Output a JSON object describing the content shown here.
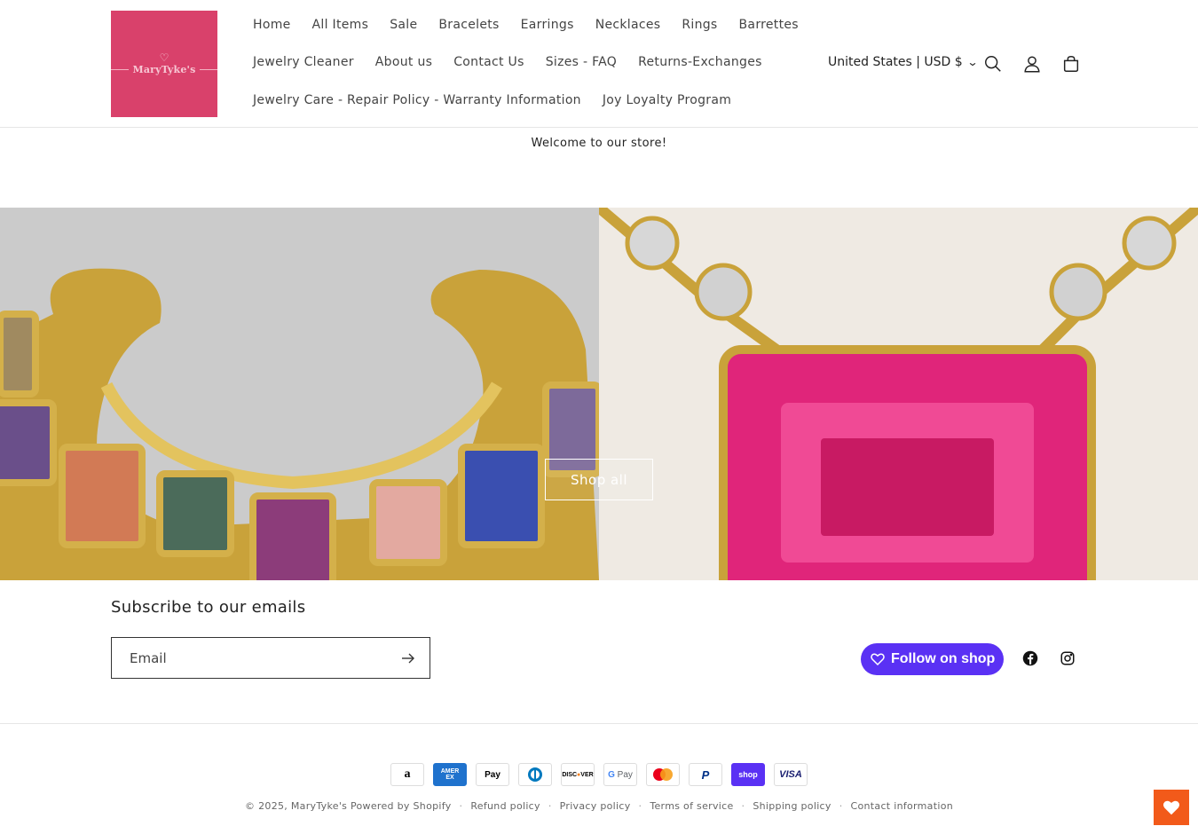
{
  "brand": {
    "logo_text": "MaryTyke's"
  },
  "nav": {
    "row1": [
      "Home",
      "All Items",
      "Sale",
      "Bracelets",
      "Earrings",
      "Necklaces",
      "Rings",
      "Barrettes"
    ],
    "row2": [
      "Jewelry Cleaner",
      "About us",
      "Contact Us",
      "Sizes - FAQ",
      "Returns-Exchanges"
    ],
    "row3": [
      "Jewelry Care - Repair Policy - Warranty Information",
      "Joy Loyalty Program"
    ]
  },
  "header": {
    "country": "United States | USD $",
    "icons": [
      "search-icon",
      "account-icon",
      "cart-icon"
    ]
  },
  "announcement": "Welcome to our store!",
  "hero": {
    "button_label": "Shop all"
  },
  "newsletter": {
    "title": "Subscribe to our emails",
    "placeholder": "Email"
  },
  "social": {
    "follow_label": "Follow on shop",
    "icons": [
      "facebook-icon",
      "instagram-icon"
    ]
  },
  "payments": [
    "Amazon",
    "American Express",
    "Apple Pay",
    "Diners Club",
    "Discover",
    "Google Pay",
    "Mastercard",
    "PayPal",
    "Shop Pay",
    "Visa"
  ],
  "footer": {
    "copyright_prefix": "© 2025,",
    "store_name": "MaryTyke's",
    "powered": "Powered by Shopify",
    "links": [
      "Refund policy",
      "Privacy policy",
      "Terms of service",
      "Shipping policy",
      "Contact information"
    ]
  },
  "colors": {
    "logo_bg": "#d9416b",
    "shop_purple": "#5a31f4",
    "wishlist_orange": "#f25a1a"
  }
}
